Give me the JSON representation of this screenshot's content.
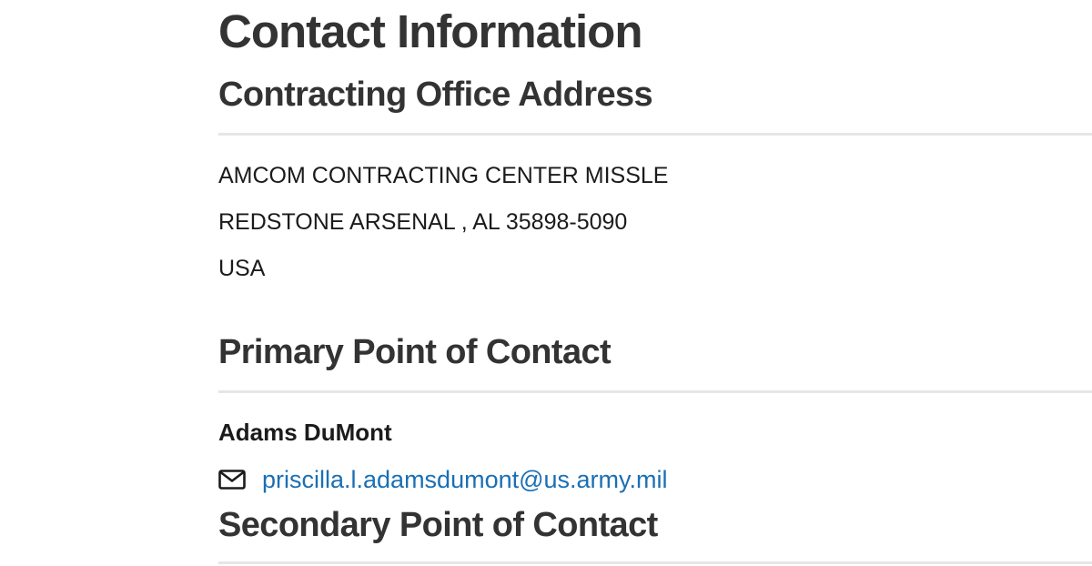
{
  "contact_information": {
    "title": "Contact Information",
    "office_address": {
      "heading": "Contracting Office Address",
      "lines": [
        "AMCOM CONTRACTING CENTER MISSLE",
        "REDSTONE ARSENAL , AL 35898-5090",
        "USA"
      ]
    },
    "primary_contact": {
      "heading": "Primary Point of Contact",
      "name": "Adams DuMont",
      "email": "priscilla.l.adamsdumont@us.army.mil",
      "email_icon": "envelope-icon"
    },
    "secondary_contact": {
      "heading": "Secondary Point of Contact"
    }
  },
  "colors": {
    "heading": "#333333",
    "body_text": "#1b1b1b",
    "link": "#1a6fb5",
    "divider": "#e6e6e6"
  }
}
